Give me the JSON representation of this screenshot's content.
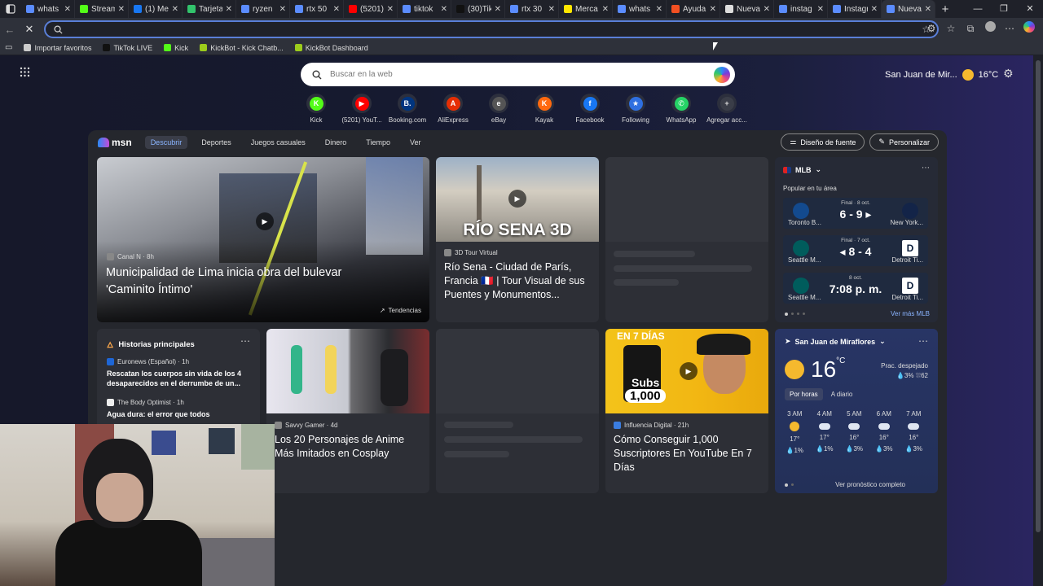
{
  "tabs": [
    {
      "title": "whats",
      "color": "#5b8cff"
    },
    {
      "title": "Stream",
      "color": "#53fc18"
    },
    {
      "title": "(1) Me",
      "color": "#1877f2"
    },
    {
      "title": "Tarjeta",
      "color": "#32c36c"
    },
    {
      "title": "ryzen",
      "color": "#5b8cff"
    },
    {
      "title": "rtx 50",
      "color": "#5b8cff"
    },
    {
      "title": "(5201)",
      "color": "#ff0000"
    },
    {
      "title": "tiktok",
      "color": "#5b8cff"
    },
    {
      "title": "(30)Tik",
      "color": "#111111"
    },
    {
      "title": "rtx 30",
      "color": "#5b8cff"
    },
    {
      "title": "Merca",
      "color": "#ffe600"
    },
    {
      "title": "whats",
      "color": "#5b8cff"
    },
    {
      "title": "Ayuda",
      "color": "#f25022"
    },
    {
      "title": "Nueva",
      "color": "#dddddd"
    },
    {
      "title": "instag",
      "color": "#5b8cff"
    },
    {
      "title": "Instagr",
      "color": "#5b8cff"
    },
    {
      "title": "Nueva",
      "color": "#5b8cff"
    }
  ],
  "address": {
    "value": ""
  },
  "bookmarks": [
    {
      "label": "Importar favoritos",
      "color": "#cccccc"
    },
    {
      "label": "TikTok LIVE",
      "color": "#111111"
    },
    {
      "label": "Kick",
      "color": "#53fc18"
    },
    {
      "label": "KickBot - Kick Chatb...",
      "color": "#9ccc1c"
    },
    {
      "label": "KickBot Dashboard",
      "color": "#9ccc1c"
    }
  ],
  "search": {
    "placeholder": "Buscar en la web"
  },
  "weather_top": {
    "location": "San Juan de Mir...",
    "temp": "16°C"
  },
  "quicklinks": [
    {
      "label": "Kick",
      "glyph": "K",
      "color": "#53fc18"
    },
    {
      "label": "(5201) YouT...",
      "glyph": "▶",
      "color": "#ff0000"
    },
    {
      "label": "Booking.com",
      "glyph": "B.",
      "color": "#003580"
    },
    {
      "label": "AliExpress",
      "glyph": "A",
      "color": "#e62e04"
    },
    {
      "label": "eBay",
      "glyph": "e",
      "color": "#555555"
    },
    {
      "label": "Kayak",
      "glyph": "K",
      "color": "#ff690f"
    },
    {
      "label": "Facebook",
      "glyph": "f",
      "color": "#1877f2"
    },
    {
      "label": "Following",
      "glyph": "★",
      "color": "#2f6fe0"
    },
    {
      "label": "WhatsApp",
      "glyph": "✆",
      "color": "#25d366"
    },
    {
      "label": "Agregar acc...",
      "glyph": "+",
      "color": "#3a3d48"
    }
  ],
  "feednav": {
    "logo": "msn",
    "items": [
      "Descubrir",
      "Deportes",
      "Juegos casuales",
      "Dinero",
      "Tiempo",
      "Ver"
    ],
    "font_btn": "Diseño de fuente",
    "customize_btn": "Personalizar"
  },
  "hero": {
    "source": "Canal N · 8h",
    "title": "Municipalidad de Lima inicia obra del bulevar 'Caminito Íntimo'",
    "trend": "Tendencias"
  },
  "rio": {
    "overlay": "RÍO SENA 3D",
    "source": "3D Tour Virtual",
    "title": "Río Sena - Ciudad de París, Francia 🇫🇷 | Tour Visual de sus Puentes y Monumentos..."
  },
  "mlb": {
    "title": "MLB",
    "subtitle": "Popular en tu área",
    "games": [
      {
        "status": "Final · 8 oct.",
        "score": "6 - 9 ▸",
        "home": "Toronto B...",
        "away": "New York..."
      },
      {
        "status": "Final · 7 oct.",
        "score": "◂ 8 - 4",
        "home": "Seattle M...",
        "away": "Detroit Ti..."
      },
      {
        "status": "8 oct.",
        "score": "7:08 p. m.",
        "home": "Seattle M...",
        "away": "Detroit Ti..."
      }
    ],
    "link": "Ver más MLB"
  },
  "historias": {
    "title": "Historias principales",
    "items": [
      {
        "source": "Euronews (Español) · 1h",
        "title": "Rescatan los cuerpos sin vida de los 4 desaparecidos en el derrumbe de un..."
      },
      {
        "source": "The Body Optimist · 1h",
        "title": "Agua dura: el error que todos"
      }
    ]
  },
  "cosplay": {
    "source": "Savvy Gamer · 4d",
    "title": "Los 20 Personajes de Anime Más Imitados en Cosplay"
  },
  "youtube": {
    "overlay_top": "EN 7 DÍAS",
    "overlay_subs": "Subs",
    "overlay_count": "1,000",
    "source": "Influencia Digital · 21h",
    "title": "Cómo Conseguir 1,000 Suscriptores En YouTube En 7 Días"
  },
  "weather_card": {
    "location": "San Juan de Miraflores",
    "temp": "16",
    "unit": "°C",
    "condition": "Prac. despejado",
    "details": "💧3%  ⛆62",
    "tabs": [
      "Por horas",
      "A diario"
    ],
    "hours": [
      {
        "time": "3 AM",
        "temp": "17°",
        "rain": "💧1%"
      },
      {
        "time": "4 AM",
        "temp": "17°",
        "rain": "💧1%"
      },
      {
        "time": "5 AM",
        "temp": "16°",
        "rain": "💧3%"
      },
      {
        "time": "6 AM",
        "temp": "16°",
        "rain": "💧3%"
      },
      {
        "time": "7 AM",
        "temp": "16°",
        "rain": "💧3%"
      }
    ],
    "link": "Ver pronóstico completo"
  }
}
